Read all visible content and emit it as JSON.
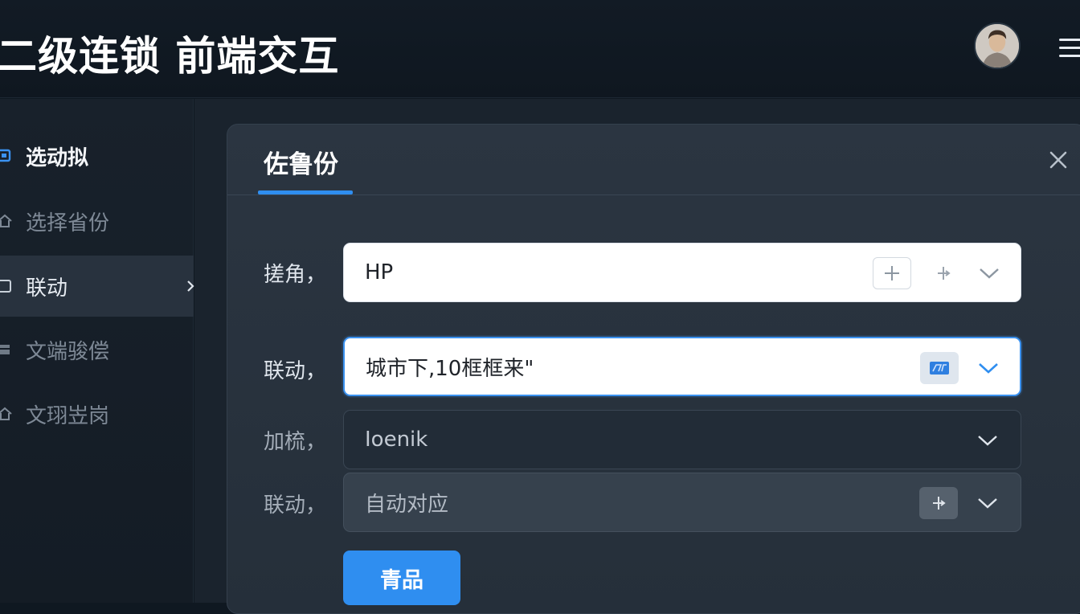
{
  "header": {
    "title": "二级连锁 前端交互"
  },
  "sidebar": {
    "items": [
      {
        "label": "选动拟",
        "icon": "select-icon"
      },
      {
        "label": "选择省份",
        "icon": "home-icon"
      },
      {
        "label": "联动",
        "icon": "square-icon"
      },
      {
        "label": "文端骏偿",
        "icon": "stack-icon"
      },
      {
        "label": "文珝岦岗",
        "icon": "home-icon"
      }
    ]
  },
  "panel": {
    "tab_label": "佐鲁份",
    "rows": [
      {
        "label": "搓角，",
        "value": "HP"
      },
      {
        "label": "联动，",
        "value": "城市下,10框框来\""
      },
      {
        "label": "加梳，",
        "value": "Ioenik"
      },
      {
        "label": "联动，",
        "value": "自动对应"
      }
    ],
    "submit_label": "青品"
  },
  "colors": {
    "accent": "#2f8ef0",
    "background": "#0f1821",
    "panel": "#2b3541"
  }
}
